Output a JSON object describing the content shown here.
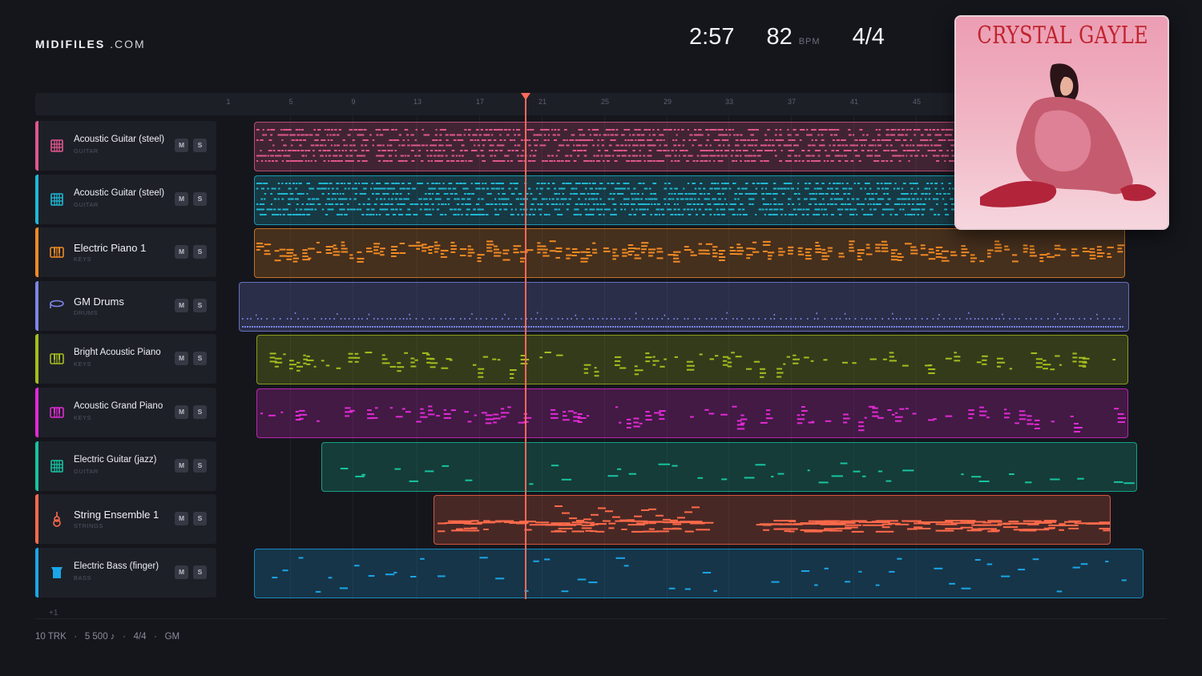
{
  "brand": {
    "name": "MIDIFILES",
    "suffix": ".COM"
  },
  "transport": {
    "time": "2:57",
    "bpm": "82",
    "bpm_unit": "BPM",
    "time_signature": "4/4"
  },
  "ruler": {
    "bars": [
      "1",
      "5",
      "9",
      "13",
      "17",
      "21",
      "25",
      "29",
      "33",
      "37",
      "41",
      "45"
    ]
  },
  "tracks": [
    {
      "name": "Acoustic Guitar (steel)",
      "category": "GUITAR",
      "icon": "guitar-icon",
      "color": "#e0578d",
      "style": "dense-hits"
    },
    {
      "name": "Acoustic Guitar (steel)",
      "category": "GUITAR",
      "icon": "guitar-icon",
      "color": "#1fb8d4",
      "style": "dense-hits"
    },
    {
      "name": "Electric Piano 1",
      "category": "KEYS",
      "icon": "keys-icon",
      "color": "#f08a24",
      "style": "chords"
    },
    {
      "name": "GM Drums",
      "category": "DRUMS",
      "icon": "drum-icon",
      "color": "#7c86e6",
      "style": "drums"
    },
    {
      "name": "Bright Acoustic Piano",
      "category": "KEYS",
      "icon": "keys-icon",
      "color": "#a5bd1c",
      "style": "melodic"
    },
    {
      "name": "Acoustic Grand Piano",
      "category": "KEYS",
      "icon": "keys-icon",
      "color": "#e22ad6",
      "style": "melodic"
    },
    {
      "name": "Electric Guitar (jazz)",
      "category": "GUITAR",
      "icon": "guitar-icon",
      "color": "#17c4a0",
      "style": "sparse"
    },
    {
      "name": "String Ensemble 1",
      "category": "STRINGS",
      "icon": "violin-icon",
      "color": "#ff6a4a",
      "style": "strings"
    },
    {
      "name": "Electric Bass (finger)",
      "category": "BASS",
      "icon": "bass-icon",
      "color": "#1aa6e8",
      "style": "bass"
    }
  ],
  "mute_label": "M",
  "solo_label": "S",
  "playhead_position": 0.27,
  "album": {
    "title": "CRYSTAL GAYLE"
  },
  "more_tracks": "+1",
  "footer": {
    "tracks": "10 TRK",
    "notes": "5 500 ♪",
    "time_signature": "4/4",
    "standard": "GM",
    "separator": "·"
  }
}
